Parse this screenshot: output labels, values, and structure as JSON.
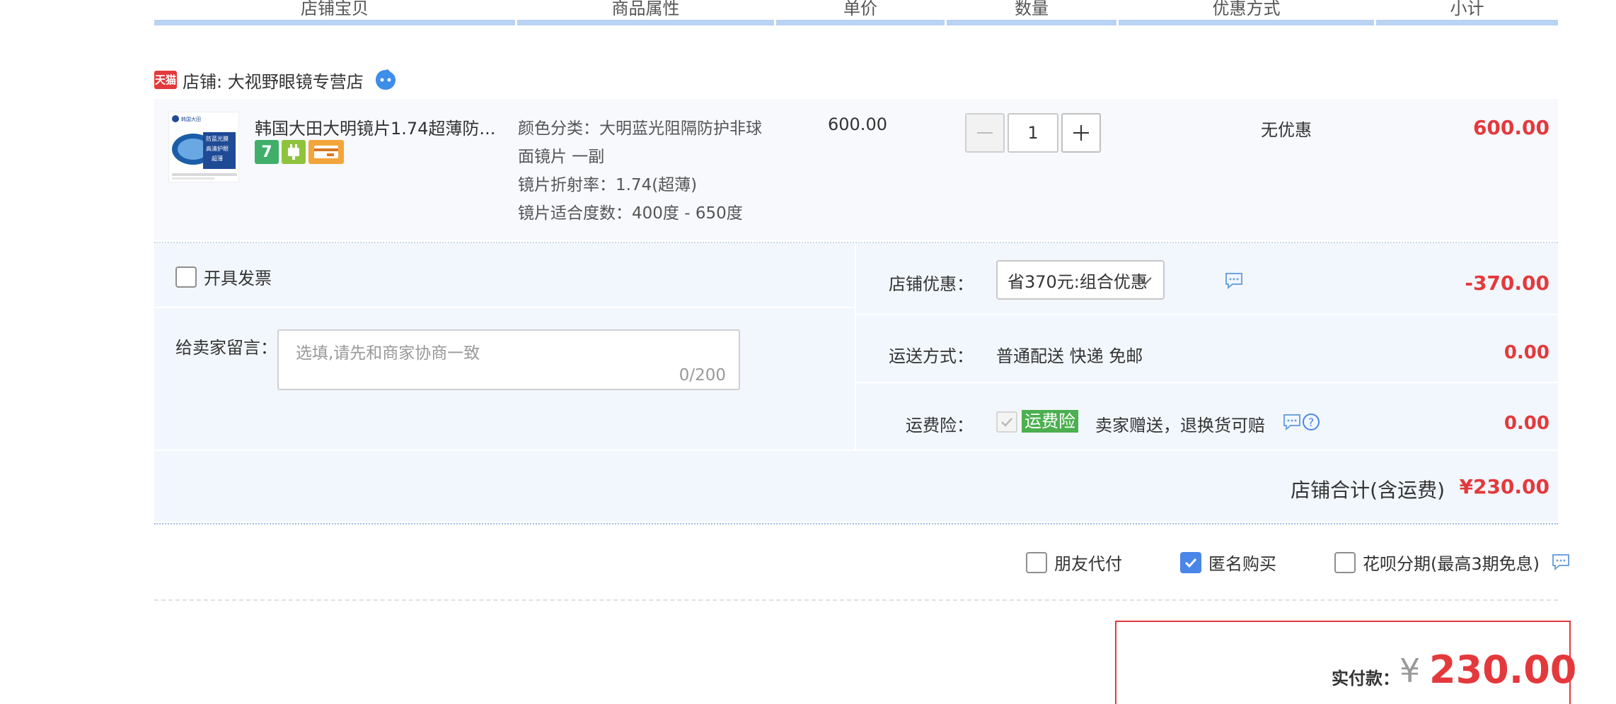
{
  "columns": [
    "店铺宝贝",
    "商品属性",
    "单价",
    "数量",
    "优惠方式",
    "小计"
  ],
  "shop": {
    "badge": "天猫",
    "label": "店铺: 大视野眼镜专营店"
  },
  "item": {
    "title": "韩国大田大明镜片1.74超薄防...",
    "attrs": [
      "颜色分类：大明蓝光阻隔防护非球",
      "面镜片 一副",
      "镜片折射率：1.74(超薄)",
      "镜片适合度数：400度 - 650度"
    ],
    "price": "600.00",
    "qty": "1",
    "promo": "无优惠",
    "subtotal": "600.00",
    "service_icons": [
      "seven-day-return-icon",
      "plug-icon",
      "card-icon"
    ],
    "thumb_text": [
      "韩国大田",
      "防蓝光膜",
      "高清护眼",
      "超薄"
    ]
  },
  "invoice": {
    "label": "开具发票"
  },
  "message": {
    "label": "给卖家留言：",
    "placeholder": "选填,请先和商家协商一致",
    "count": "0/200"
  },
  "shop_discount": {
    "label": "店铺优惠：",
    "selected": "省370元:组合优惠",
    "amount": "-370.00"
  },
  "shipping": {
    "label": "运送方式：",
    "value": "普通配送 快递 免邮",
    "amount": "0.00"
  },
  "insurance": {
    "label": "运费险：",
    "tag": "运费险",
    "text": "卖家赠送，退换货可赔",
    "amount": "0.00"
  },
  "shop_total": {
    "label": "店铺合计(含运费)",
    "value": "¥230.00"
  },
  "options": {
    "friend_pay": "朋友代付",
    "anonymous": "匿名购买",
    "huabei": "花呗分期(最高3期免息)"
  },
  "pay": {
    "label": "实付款：",
    "currency": "¥",
    "amount": "230.00"
  },
  "colors": {
    "accent_red": "#e4393c",
    "header_bar": "#b8d3f3",
    "panel_bg": "#f2f7fd",
    "checkbox_blue": "#4a85e8",
    "insurance_green": "#4caf50"
  }
}
